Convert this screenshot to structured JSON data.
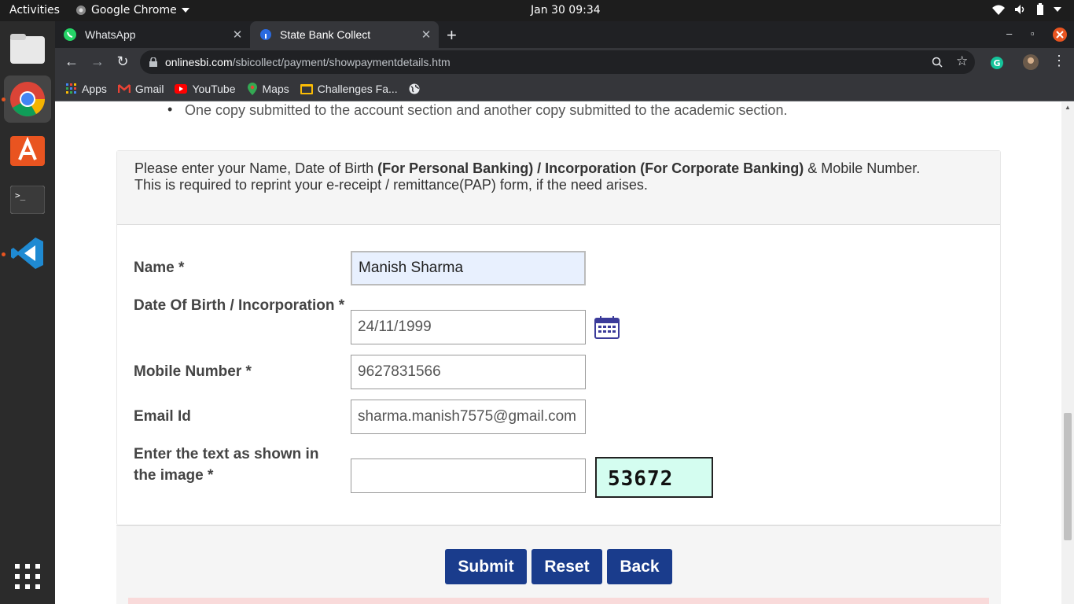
{
  "topbar": {
    "activities": "Activities",
    "app_name": "Google Chrome",
    "clock": "Jan 30  09:34"
  },
  "tabs": [
    {
      "title": "WhatsApp"
    },
    {
      "title": "State Bank Collect"
    }
  ],
  "omnibox": {
    "host": "onlinesbi.com",
    "path": "/sbicollect/payment/showpaymentdetails.htm"
  },
  "bookmarks": [
    {
      "label": "Apps",
      "icon": "apps-grid-icon"
    },
    {
      "label": "Gmail",
      "icon": "gmail-icon"
    },
    {
      "label": "YouTube",
      "icon": "youtube-icon"
    },
    {
      "label": "Maps",
      "icon": "maps-icon"
    },
    {
      "label": "Challenges Fa...",
      "icon": "folder-icon"
    }
  ],
  "page": {
    "bullet_text": "One copy submitted to the account section and another copy submitted to the academic section.",
    "intro": {
      "line1_a": "Please enter your Name, Date of Birth ",
      "line1_bold": "(For Personal Banking) / Incorporation (For Corporate Banking)",
      "line1_b": "  & Mobile Number.",
      "line2": "This is required to reprint your e-receipt / remittance(PAP) form, if the need arises."
    },
    "form": {
      "name_label": "Name *",
      "name_value": "Manish Sharma",
      "dob_label": "Date Of Birth / Incorporation *",
      "dob_value": "24/11/1999",
      "mobile_label": "Mobile Number *",
      "mobile_value": "9627831566",
      "email_label": "Email Id",
      "email_value": "sharma.manish7575@gmail.com",
      "captcha_label": "Enter the text as shown in the image *",
      "captcha_value": "",
      "captcha_image_text": "53672"
    },
    "buttons": {
      "submit": "Submit",
      "reset": "Reset",
      "back": "Back"
    }
  },
  "colors": {
    "button_bg": "#1a3c8c",
    "autofill_bg": "#e8f0fe",
    "captcha_bg": "#d4fdf0"
  }
}
